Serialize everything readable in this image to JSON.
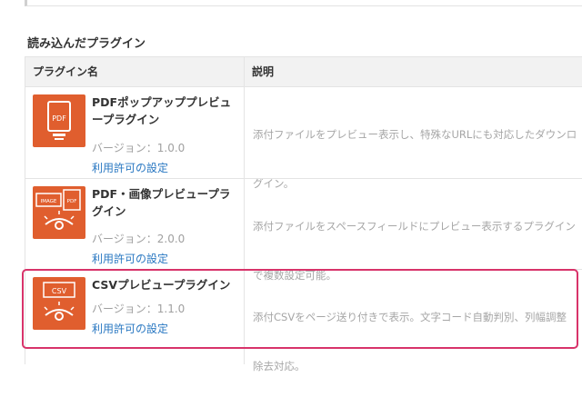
{
  "section": {
    "title": "読み込んだプラグイン"
  },
  "table": {
    "headers": {
      "name": "プラグイン名",
      "description": "説明"
    },
    "plugins": [
      {
        "title_line1": "PDFポップアッププレビュ",
        "title_line2": "ープラグイン",
        "icon": "pdf-popup-icon",
        "icon_label": "PDF",
        "version": "バージョン：1.0.0",
        "permission_link": "利用許可の設定",
        "desc_line1": "添付ファイルをプレビュー表示し、特殊なURLにも対応したダウンロ",
        "desc_line2": "グイン。"
      },
      {
        "title_line1": "PDF・画像プレビュープラ",
        "title_line2": "グイン",
        "icon": "pdf-image-preview-icon",
        "icon_label_a": "IMAGE",
        "icon_label_b": "PDF",
        "version": "バージョン：2.0.0",
        "permission_link": "利用許可の設定",
        "desc_line1": "添付ファイルをスペースフィールドにプレビュー表示するプラグイン",
        "desc_line2": "で複数設定可能。"
      },
      {
        "title_line1": "CSVプレビュープラグイン",
        "title_line2": "",
        "icon": "csv-preview-icon",
        "icon_label": "CSV",
        "version": "バージョン：1.1.0",
        "permission_link": "利用許可の設定",
        "desc_line1": "添付CSVをページ送り付きで表示。文字コード自動判別、列幅調整",
        "desc_line2": "除去対応。"
      }
    ]
  },
  "colors": {
    "icon_bg": "#e05e2e",
    "link": "#2a78c2",
    "highlight": "#d8336a"
  }
}
